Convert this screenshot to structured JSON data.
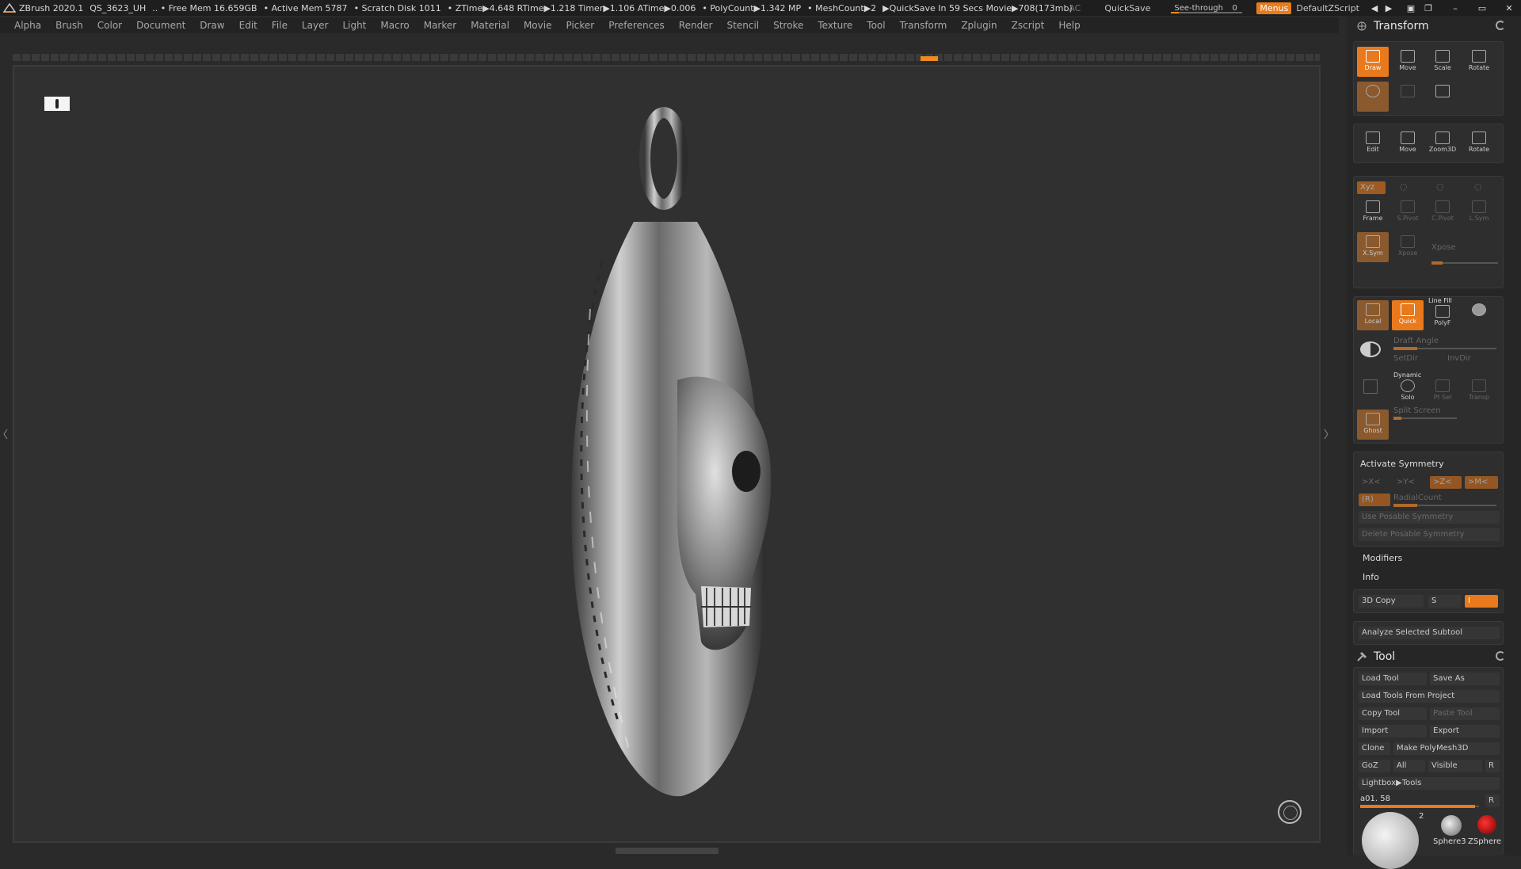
{
  "titlebar": {
    "app": "ZBrush 2020.1",
    "document": "QS_3623_UH",
    "free_mem": ".. • Free Mem 16.659GB",
    "active_mem": "• Active Mem 5787",
    "scratch": "• Scratch Disk 1011",
    "timers": "• ZTime▶4.648 RTime▶1.218 Timer▶1.106 ATime▶0.006",
    "polycount": "• PolyCount▶1.342 MP",
    "meshcount": "• MeshCount▶2",
    "quicksave": "▶QuickSave In 59 Secs Movie▶708(173mb)",
    "ac": "AC",
    "quicksave_btn": "QuickSave",
    "see_through_label": "See-through",
    "see_through_value": "0",
    "menus_btn": "Menus",
    "script_name": "DefaultZScript"
  },
  "menubar": [
    "Alpha",
    "Brush",
    "Color",
    "Document",
    "Draw",
    "Edit",
    "File",
    "Layer",
    "Light",
    "Macro",
    "Marker",
    "Material",
    "Movie",
    "Picker",
    "Preferences",
    "Render",
    "Stencil",
    "Stroke",
    "Texture",
    "Tool",
    "Transform",
    "Zplugin",
    "Zscript",
    "Help"
  ],
  "transform": {
    "title": "Transform",
    "row1": [
      "Draw",
      "Move",
      "Scale",
      "Rotate"
    ],
    "row3": [
      "Edit",
      "Move",
      "Zoom3D",
      "Rotate"
    ],
    "xyz": "Xyz",
    "row_frame": [
      "Frame",
      "S.Pivot",
      "C.Pivot",
      "L.Sym"
    ],
    "row_sym": [
      "X.Sym",
      "Xpose"
    ],
    "xpose_label": "Xpose",
    "row_local": [
      "Local",
      "Quick",
      "PolyF"
    ],
    "line_fill": "Line Fill",
    "draft_angle": "Draft Angle",
    "setdir": "SetDir",
    "invdir": "InvDir",
    "dynamic": "Dynamic",
    "row_solo": [
      "Solo",
      "Pt Sel",
      "Transp"
    ],
    "split_screen": "Split Screen",
    "ghost": "Ghost",
    "activate_symmetry": "Activate Symmetry",
    "sym_x": ">X<",
    "sym_y": ">Y<",
    "sym_z": ">Z<",
    "sym_m": ">M<",
    "sym_r": "(R)",
    "radial_count": "RadialCount",
    "use_posable": "Use Posable Symmetry",
    "delete_posable": "Delete Posable Symmetry",
    "modifiers": "Modifiers",
    "info": "Info",
    "copy3d": "3D Copy",
    "copy3d_s": "S",
    "copy3d_i": "I",
    "analyze": "Analyze Selected Subtool"
  },
  "tool": {
    "title": "Tool",
    "load_tool": "Load Tool",
    "save_as": "Save As",
    "load_from_project": "Load Tools From Project",
    "copy_tool": "Copy Tool",
    "paste_tool": "Paste Tool",
    "import": "Import",
    "export": "Export",
    "clone": "Clone",
    "make_polymesh": "Make PolyMesh3D",
    "goz": "GoZ",
    "all": "All",
    "visible": "Visible",
    "r": "R",
    "lightbox": "Lightbox▶Tools",
    "current_tool": "a01. 58",
    "tool_r": "R",
    "thumb_count": "2",
    "thumbs": [
      "Sphere3",
      "ZSphere"
    ]
  }
}
